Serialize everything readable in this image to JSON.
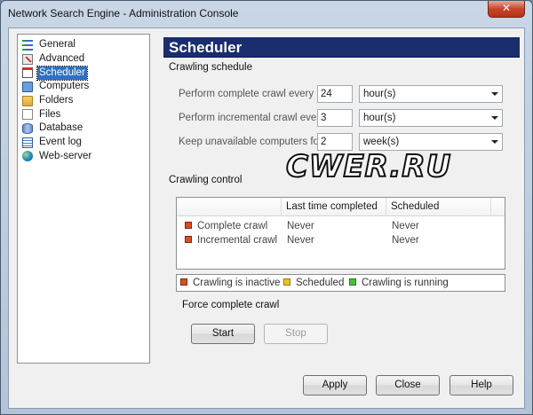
{
  "window": {
    "title": "Network Search Engine - Administration Console",
    "close_glyph": "✕"
  },
  "sidebar": {
    "items": [
      {
        "label": "General",
        "icon": "list-icon"
      },
      {
        "label": "Advanced",
        "icon": "tools-icon"
      },
      {
        "label": "Scheduler",
        "icon": "calendar-icon",
        "selected": true
      },
      {
        "label": "Computers",
        "icon": "computer-icon"
      },
      {
        "label": "Folders",
        "icon": "folder-icon"
      },
      {
        "label": "Files",
        "icon": "file-icon"
      },
      {
        "label": "Database",
        "icon": "database-icon"
      },
      {
        "label": "Event log",
        "icon": "event-log-icon"
      },
      {
        "label": "Web-server",
        "icon": "globe-icon"
      }
    ]
  },
  "panel": {
    "title": "Scheduler"
  },
  "crawling_schedule": {
    "label": "Crawling schedule",
    "rows": [
      {
        "label": "Perform complete crawl every",
        "value": "24",
        "unit": "hour(s)"
      },
      {
        "label": "Perform incremental crawl every",
        "value": "3",
        "unit": "hour(s)"
      },
      {
        "label": "Keep unavailable computers for",
        "value": "2",
        "unit": "week(s)"
      }
    ]
  },
  "crawling_control": {
    "label": "Crawling control",
    "columns": [
      "",
      "Last time completed",
      "Scheduled"
    ],
    "rows": [
      {
        "name": "Complete crawl",
        "last": "Never",
        "scheduled": "Never",
        "status": "inactive"
      },
      {
        "name": "Incremental crawl",
        "last": "Never",
        "scheduled": "Never",
        "status": "inactive"
      }
    ]
  },
  "legend": {
    "inactive": "Crawling is inactive",
    "scheduled": "Scheduled",
    "running": "Crawling is running"
  },
  "force_crawl": {
    "label": "Force complete crawl",
    "start": "Start",
    "stop": "Stop"
  },
  "footer": {
    "apply": "Apply",
    "close": "Close",
    "help": "Help"
  },
  "watermark": "CWER.RU",
  "colors": {
    "header_bg": "#1a2e6e",
    "inactive": "#d8501c",
    "scheduled": "#f0c020",
    "running": "#4abf3a",
    "selection": "#3070c0"
  }
}
